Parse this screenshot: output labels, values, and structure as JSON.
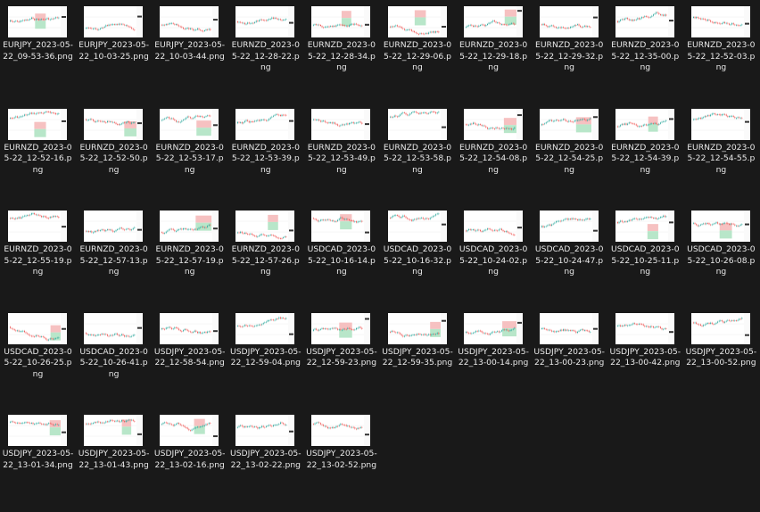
{
  "explorer": {
    "files": [
      {
        "name": "EURJPY_2023-05-22_09-53-36.png",
        "icon": "image-thumbnail"
      },
      {
        "name": "EURJPY_2023-05-22_10-03-25.png",
        "icon": "image-thumbnail"
      },
      {
        "name": "EURJPY_2023-05-22_10-03-44.png",
        "icon": "image-thumbnail"
      },
      {
        "name": "EURNZD_2023-05-22_12-28-22.png",
        "icon": "image-thumbnail"
      },
      {
        "name": "EURNZD_2023-05-22_12-28-34.png",
        "icon": "image-thumbnail"
      },
      {
        "name": "EURNZD_2023-05-22_12-29-06.png",
        "icon": "image-thumbnail"
      },
      {
        "name": "EURNZD_2023-05-22_12-29-18.png",
        "icon": "image-thumbnail"
      },
      {
        "name": "EURNZD_2023-05-22_12-29-32.png",
        "icon": "image-thumbnail"
      },
      {
        "name": "EURNZD_2023-05-22_12-35-00.png",
        "icon": "image-thumbnail"
      },
      {
        "name": "EURNZD_2023-05-22_12-52-03.png",
        "icon": "image-thumbnail"
      },
      {
        "name": "EURNZD_2023-05-22_12-52-16.png",
        "icon": "image-thumbnail"
      },
      {
        "name": "EURNZD_2023-05-22_12-52-50.png",
        "icon": "image-thumbnail"
      },
      {
        "name": "EURNZD_2023-05-22_12-53-17.png",
        "icon": "image-thumbnail"
      },
      {
        "name": "EURNZD_2023-05-22_12-53-39.png",
        "icon": "image-thumbnail"
      },
      {
        "name": "EURNZD_2023-05-22_12-53-49.png",
        "icon": "image-thumbnail"
      },
      {
        "name": "EURNZD_2023-05-22_12-53-58.png",
        "icon": "image-thumbnail"
      },
      {
        "name": "EURNZD_2023-05-22_12-54-08.png",
        "icon": "image-thumbnail"
      },
      {
        "name": "EURNZD_2023-05-22_12-54-25.png",
        "icon": "image-thumbnail"
      },
      {
        "name": "EURNZD_2023-05-22_12-54-39.png",
        "icon": "image-thumbnail"
      },
      {
        "name": "EURNZD_2023-05-22_12-54-55.png",
        "icon": "image-thumbnail"
      },
      {
        "name": "EURNZD_2023-05-22_12-55-19.png",
        "icon": "image-thumbnail"
      },
      {
        "name": "EURNZD_2023-05-22_12-57-13.png",
        "icon": "image-thumbnail"
      },
      {
        "name": "EURNZD_2023-05-22_12-57-19.png",
        "icon": "image-thumbnail"
      },
      {
        "name": "EURNZD_2023-05-22_12-57-26.png",
        "icon": "image-thumbnail"
      },
      {
        "name": "USDCAD_2023-05-22_10-16-14.png",
        "icon": "image-thumbnail"
      },
      {
        "name": "USDCAD_2023-05-22_10-16-32.png",
        "icon": "image-thumbnail"
      },
      {
        "name": "USDCAD_2023-05-22_10-24-02.png",
        "icon": "image-thumbnail"
      },
      {
        "name": "USDCAD_2023-05-22_10-24-47.png",
        "icon": "image-thumbnail"
      },
      {
        "name": "USDCAD_2023-05-22_10-25-11.png",
        "icon": "image-thumbnail"
      },
      {
        "name": "USDCAD_2023-05-22_10-26-08.png",
        "icon": "image-thumbnail"
      },
      {
        "name": "USDCAD_2023-05-22_10-26-25.png",
        "icon": "image-thumbnail"
      },
      {
        "name": "USDCAD_2023-05-22_10-26-41.png",
        "icon": "image-thumbnail"
      },
      {
        "name": "USDJPY_2023-05-22_12-58-54.png",
        "icon": "image-thumbnail"
      },
      {
        "name": "USDJPY_2023-05-22_12-59-04.png",
        "icon": "image-thumbnail"
      },
      {
        "name": "USDJPY_2023-05-22_12-59-23.png",
        "icon": "image-thumbnail"
      },
      {
        "name": "USDJPY_2023-05-22_12-59-35.png",
        "icon": "image-thumbnail"
      },
      {
        "name": "USDJPY_2023-05-22_13-00-14.png",
        "icon": "image-thumbnail"
      },
      {
        "name": "USDJPY_2023-05-22_13-00-23.png",
        "icon": "image-thumbnail"
      },
      {
        "name": "USDJPY_2023-05-22_13-00-42.png",
        "icon": "image-thumbnail"
      },
      {
        "name": "USDJPY_2023-05-22_13-00-52.png",
        "icon": "image-thumbnail"
      },
      {
        "name": "USDJPY_2023-05-22_13-01-34.png",
        "icon": "image-thumbnail"
      },
      {
        "name": "USDJPY_2023-05-22_13-01-43.png",
        "icon": "image-thumbnail"
      },
      {
        "name": "USDJPY_2023-05-22_13-02-16.png",
        "icon": "image-thumbnail"
      },
      {
        "name": "USDJPY_2023-05-22_13-02-22.png",
        "icon": "image-thumbnail"
      },
      {
        "name": "USDJPY_2023-05-22_13-02-52.png",
        "icon": "image-thumbnail"
      }
    ]
  },
  "theme": {
    "background": "#191919",
    "label_color": "#e9e9e9",
    "thumbnail_bg": "#ffffff",
    "candle_up": "#26a69a",
    "candle_down": "#ef5350",
    "position_profit": "#b8e6c9",
    "position_loss": "#f6c1c1"
  }
}
